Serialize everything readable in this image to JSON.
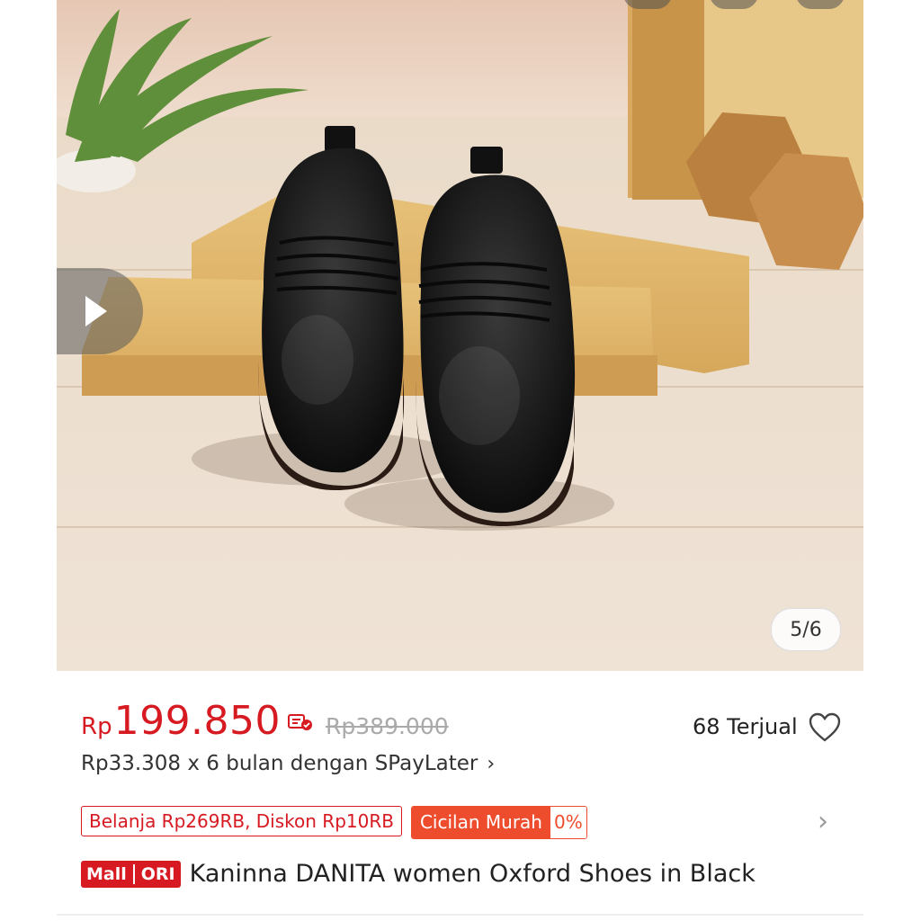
{
  "gallery": {
    "image_counter": "5/6",
    "play_icon": "play-icon"
  },
  "price": {
    "currency": "Rp",
    "current": "199.850",
    "original": "Rp389.000",
    "coin_icon": "shopee-coin-icon",
    "accent_color": "#d71a21"
  },
  "sold": {
    "label": "68 Terjual",
    "icon": "heart-outline-icon"
  },
  "paylater": {
    "text": "Rp33.308 x 6 bulan dengan SPayLater",
    "chevron": "›"
  },
  "promos": {
    "discount": "Belanja Rp269RB, Diskon Rp10RB",
    "installment_label": "Cicilan Murah",
    "installment_rate": "0%",
    "chevron": "›",
    "installment_color": "#ee4d2d"
  },
  "product": {
    "badge_left": "Mall",
    "badge_right": "ORI",
    "title": "Kaninna DANITA women Oxford Shoes in Black"
  }
}
